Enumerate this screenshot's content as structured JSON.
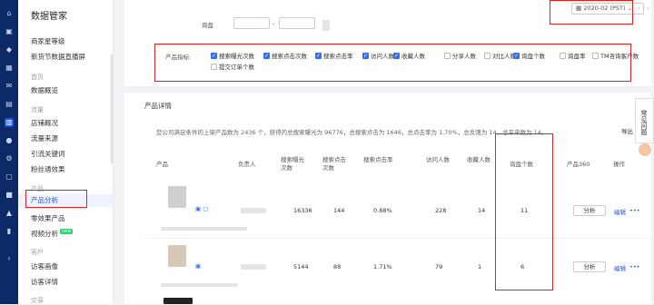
{
  "sidebar": {
    "title": "数据管家",
    "items": [
      {
        "label": "商家星等级"
      },
      {
        "label": "新货节数据直播屏"
      }
    ],
    "sections": [
      {
        "label": "首页",
        "items": [
          "数据概览"
        ]
      },
      {
        "label": "流量",
        "items": [
          "店铺概况",
          "流量来源",
          "引流关键词",
          "粉丝通效果"
        ]
      },
      {
        "label": "产品",
        "items": [
          "产品分析",
          "零效果产品",
          "视频分析"
        ]
      },
      {
        "label": "客户",
        "items": [
          "访客画像",
          "访客详情"
        ]
      },
      {
        "label": "交易",
        "items": []
      }
    ],
    "new_badge": "new"
  },
  "filter": {
    "inquiry_label": "询盘",
    "range_sep": "-",
    "date_value": "2020-02 (PST)",
    "metric_label": "产品指标:",
    "metrics": [
      {
        "label": "搜索曝光次数",
        "checked": true
      },
      {
        "label": "搜索点击次数",
        "checked": true
      },
      {
        "label": "搜索点击率",
        "checked": true
      },
      {
        "label": "访问人数",
        "checked": true
      },
      {
        "label": "收藏人数",
        "checked": true
      },
      {
        "label": "分享人数",
        "checked": false
      },
      {
        "label": "对比人数",
        "checked": false
      },
      {
        "label": "询盘个数",
        "checked": true
      },
      {
        "label": "询盘率",
        "checked": false
      },
      {
        "label": "TM咨询客户数",
        "checked": false
      },
      {
        "label": "提交订单个数",
        "checked": false
      }
    ]
  },
  "details": {
    "title": "产品详情",
    "export": "导出",
    "summary": "您公司满足条件的上架产品数为 2436 个，获得的总搜索曝光为 96776，总搜索点击为 1646，总点击率为 1.70%，总反馈为 14，总平单数为 14。",
    "columns": [
      "产品",
      "负责人",
      "搜索曝光次数",
      "搜索点击次数",
      "搜索点击率",
      "访问人数",
      "收藏人数",
      "询盘个数",
      "产品360",
      "操作"
    ],
    "rows": [
      {
        "exposure": "16336",
        "clicks": "144",
        "ctr": "0.88%",
        "visitors": "228",
        "favorites": "14",
        "inquiries": "11",
        "analyze": "分析",
        "edit": "编辑",
        "more": "•••"
      },
      {
        "exposure": "5144",
        "clicks": "88",
        "ctr": "1.71%",
        "visitors": "79",
        "favorites": "1",
        "inquiries": "6",
        "analyze": "分析",
        "edit": "编辑",
        "more": "•••"
      }
    ]
  },
  "faq": "常见问题",
  "colors": {
    "accent": "#1a56db",
    "rail": "#0b2a66",
    "highlight": "#e02020"
  }
}
